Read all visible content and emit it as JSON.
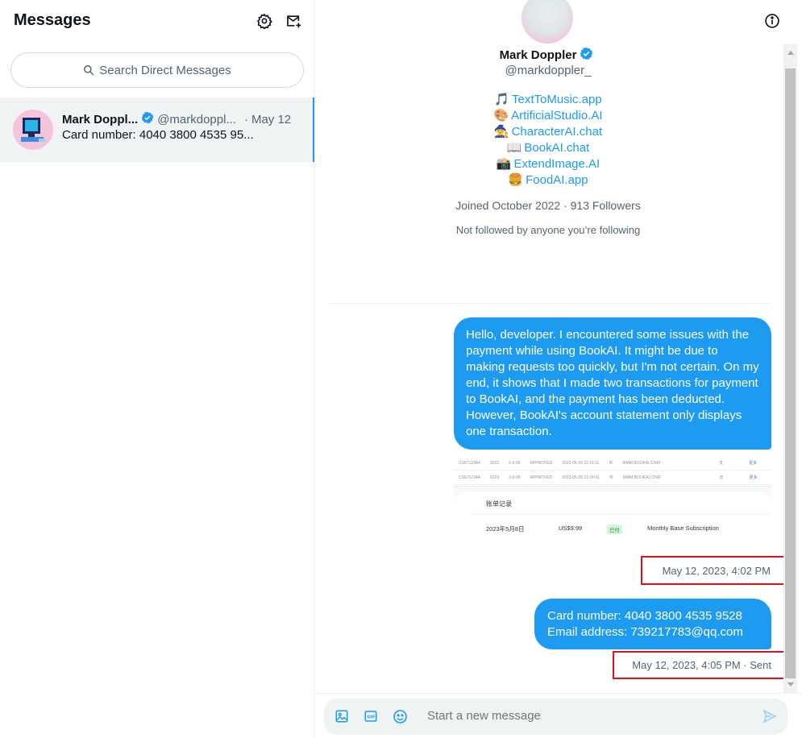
{
  "left": {
    "title": "Messages",
    "search_placeholder": "Search Direct Messages",
    "conversation": {
      "name": "Mark Doppl...",
      "handle": "@markdoppl...",
      "separator": "·",
      "date": "May 12",
      "preview": "Card number: 4040 3800 4535 95..."
    }
  },
  "profile": {
    "name": "Mark Doppler",
    "handle": "@markdoppler_",
    "links": [
      {
        "emoji": "🎵",
        "text": "TextToMusic.app"
      },
      {
        "emoji": "🎨",
        "text": "ArtificialStudio.AI"
      },
      {
        "emoji": "🧙",
        "text": "CharacterAI.chat"
      },
      {
        "emoji": "📖",
        "text": "BookAI.chat"
      },
      {
        "emoji": "📸",
        "text": "ExtendImage.AI"
      },
      {
        "emoji": "🍔",
        "text": "FoodAI.app"
      }
    ],
    "joined": "Joined October 2022 · 913 Followers",
    "not_followed": "Not followed by anyone you’re following"
  },
  "messages": [
    {
      "text": "Hello, developer. I encountered some issues with the payment while using BookAI. It might be due to making requests too quickly, but I'm not certain. On my end, it shows that I made two transactions for payment to BookAI, and the payment has been deducted. However, BookAI's account statement only displays one transaction.",
      "attachment": {
        "rows": [
          [
            "CS67123A4",
            "9223",
            "5-9-99",
            "APPROVED",
            "2023-05-09 22:16:11",
            "币",
            "MMM.BOOKAI.CHAT",
            "支",
            "更多"
          ],
          [
            "CS671234A",
            "9223",
            "3-9-99",
            "APPROVED",
            "2023-05-09 21:24:41",
            "币",
            "MMM.BOOKAI.CHAT",
            "支",
            "更多"
          ]
        ],
        "card_title": "账单记录",
        "date": "2023年5月8日",
        "amount": "US$9.99",
        "status": "已付",
        "description": "Monthly Base Subscription"
      },
      "timestamp": "May 12, 2023, 4:02 PM"
    },
    {
      "line1": "Card number: 4040 3800 4535 9528",
      "line2": "Email address: 739217783@qq.com",
      "timestamp": "May 12, 2023, 4:05 PM · Sent"
    }
  ],
  "composer": {
    "placeholder": "Start a new message"
  },
  "colors": {
    "accent": "#1d9bf0",
    "highlight_box": "#e0101f",
    "selected_bg": "#eff3f4"
  }
}
